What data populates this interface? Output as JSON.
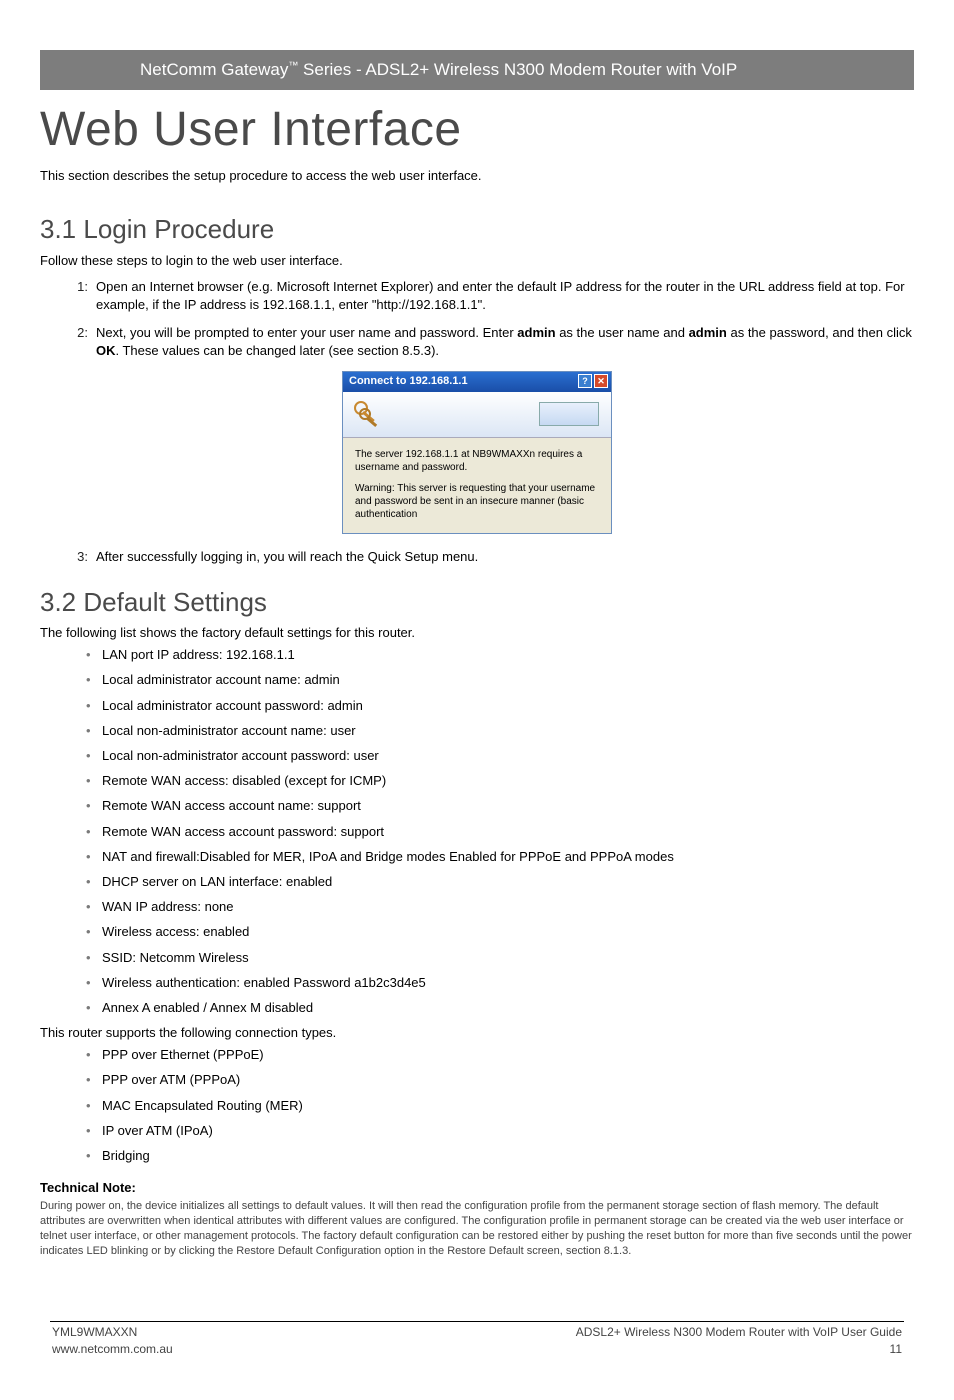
{
  "header": {
    "brand_prefix": "NetComm Gateway",
    "tm": "™",
    "brand_suffix": " Series - ADSL2+ Wireless N300 Modem Router with VoIP"
  },
  "title": "Web User Interface",
  "intro": "This section describes the setup procedure to access the web user interface.",
  "s31": {
    "heading": "3.1 Login Procedure",
    "lead": "Follow these steps to login to the web user interface.",
    "steps": {
      "s1": {
        "num": "1:",
        "text": "Open an Internet browser (e.g. Microsoft Internet Explorer) and enter the default IP address for the router in the URL address field at top. For example, if the IP address is 192.168.1.1, enter \"http://192.168.1.1\"."
      },
      "s2": {
        "num": "2:",
        "t1": "Next, you will be prompted to enter your user name and password. Enter ",
        "b1": "admin",
        "t2": " as the user name and ",
        "b2": "admin",
        "t3": " as the password, and then click ",
        "b3": "OK",
        "t4": ". These values can be changed later (see section 8.5.3)."
      },
      "s3": {
        "num": "3:",
        "text": "After successfully logging in, you will reach the Quick Setup menu."
      }
    }
  },
  "dialog": {
    "title": "Connect to 192.168.1.1",
    "help": "?",
    "close": "✕",
    "line1": "The server 192.168.1.1 at NB9WMAXXn requires a username and password.",
    "line2": "Warning: This server is requesting that your username and password be sent in an insecure manner (basic authentication"
  },
  "s32": {
    "heading": "3.2 Default Settings",
    "lead": "The following list shows the factory default settings for this router.",
    "bullets": [
      "LAN port IP address: 192.168.1.1",
      "Local administrator account name: admin",
      "Local administrator account password: admin",
      "Local non-administrator account name: user",
      "Local non-administrator account password: user",
      "Remote WAN access: disabled (except for ICMP)",
      "Remote WAN access account name: support",
      "Remote WAN access account password: support",
      "NAT and firewall:Disabled for MER, IPoA and Bridge modes Enabled for PPPoE and PPPoA modes",
      "DHCP server on LAN interface: enabled",
      "WAN IP address: none",
      "Wireless access: enabled",
      "SSID: Netcomm Wireless",
      "Wireless authentication: enabled Password a1b2c3d4e5",
      "Annex A enabled / Annex M disabled"
    ],
    "conn_lead": "This router supports the following connection types.",
    "conn": [
      "PPP over Ethernet (PPPoE)",
      "PPP over ATM (PPPoA)",
      "MAC Encapsulated Routing (MER)",
      "IP over ATM (IPoA)",
      "Bridging"
    ]
  },
  "tech": {
    "head": "Technical Note:",
    "body": "During power on, the device initializes all settings to default values. It will then read the configuration profile from the permanent storage section of flash memory. The default attributes are overwritten when identical attributes with different values are configured. The configuration profile in permanent storage can be created via the web user interface or telnet user interface, or other management protocols. The factory default configuration can be restored either by pushing the reset button for more than five seconds until the power indicates LED blinking or by clicking the Restore Default Configuration option in the Restore Default screen, section 8.1.3."
  },
  "footer": {
    "left1": "YML9WMAXXN",
    "left2": "www.netcomm.com.au",
    "right1": "ADSL2+ Wireless N300 Modem Router with VoIP User Guide",
    "right2": "11"
  }
}
